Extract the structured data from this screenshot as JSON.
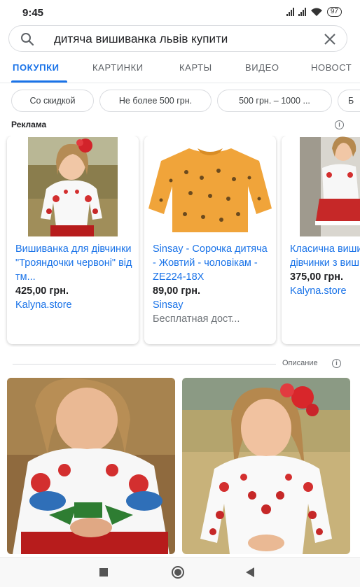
{
  "status_bar": {
    "time": "9:45",
    "battery": "97"
  },
  "search": {
    "query": "дитяча вишиванка львів купити"
  },
  "tabs": [
    {
      "label": "ПОКУПКИ",
      "active": true
    },
    {
      "label": "КАРТИНКИ",
      "active": false
    },
    {
      "label": "КАРТЫ",
      "active": false
    },
    {
      "label": "ВИДЕО",
      "active": false
    },
    {
      "label": "НОВОСТ",
      "active": false
    }
  ],
  "chips": [
    "Со скидкой",
    "Не более 500 грн.",
    "500 грн. – 1000 ...",
    "Б"
  ],
  "ads": {
    "label": "Реклама"
  },
  "products": [
    {
      "title": "Вишиванка для дівчинки \"Трояндочки червоні\" від тм...",
      "price": "425,00 грн.",
      "store": "Kalyna.store",
      "shipping": ""
    },
    {
      "title": "Sinsay - Сорочка дитяча - Жовтий - чоловікам - ZE224-18X",
      "price": "89,00 грн.",
      "store": "Sinsay",
      "shipping": "Бесплатная дост..."
    },
    {
      "title": "Класична вишиванка дівчинки з вишивкою...",
      "price": "375,00 грн.",
      "store": "Kalyna.store",
      "shipping": ""
    }
  ],
  "description_label": "Описание",
  "colors": {
    "accent": "#1a73e8",
    "link": "#1a73e8",
    "border": "#dadce0"
  },
  "icons": [
    "search-icon",
    "close-icon",
    "info-icon",
    "square-nav-icon",
    "home-circle-nav-icon",
    "back-triangle-nav-icon"
  ]
}
